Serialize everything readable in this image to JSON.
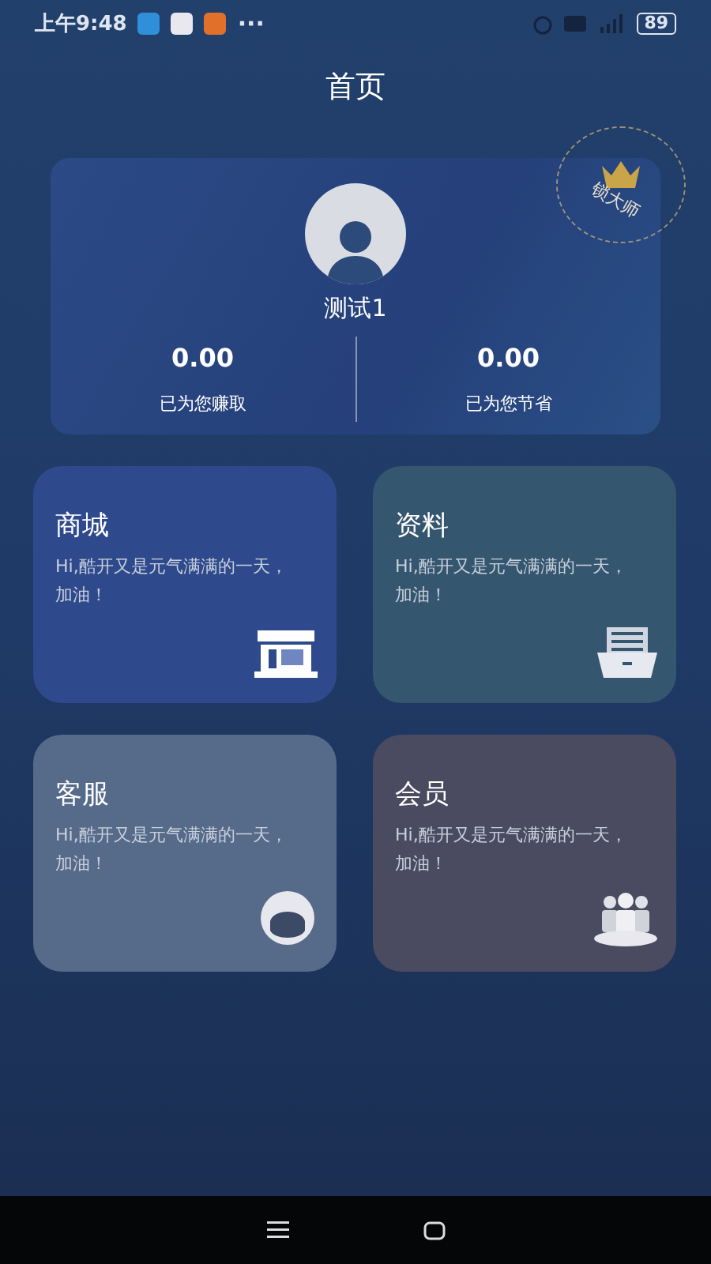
{
  "status_bar": {
    "time": "上午9:48",
    "more": "···",
    "battery": "89"
  },
  "title": "首页",
  "profile": {
    "name": "测试1",
    "badge": "锁大师",
    "stats": [
      {
        "value": "0.00",
        "label": "已为您赚取"
      },
      {
        "value": "0.00",
        "label": "已为您节省"
      }
    ]
  },
  "tiles": [
    {
      "title": "商城",
      "text": "Hi,酷开又是元气满满的一天，加油！",
      "kind": "store",
      "color": "#2f4a8c"
    },
    {
      "title": "资料",
      "text": "Hi,酷开又是元气满满的一天，加油！",
      "kind": "tray",
      "color": "#35566f"
    },
    {
      "title": "客服",
      "text": "Hi,酷开又是元气满满的一天，加油！",
      "kind": "agent",
      "color": "#566a8a"
    },
    {
      "title": "会员",
      "text": "Hi,酷开又是元气满满的一天，加油！",
      "kind": "group",
      "color": "#4a4a60"
    }
  ]
}
